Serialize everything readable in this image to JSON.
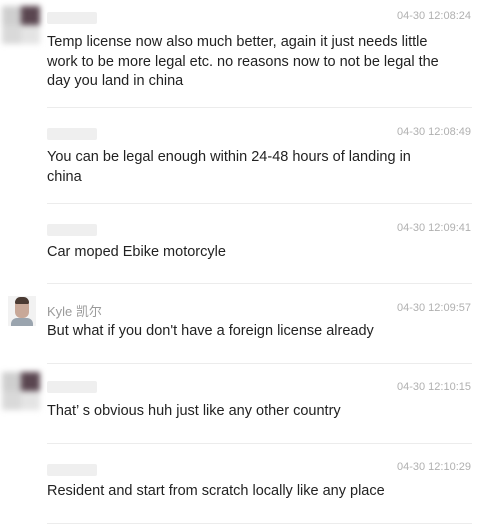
{
  "messages": [
    {
      "sender": "",
      "timestamp": "04-30 12:08:24",
      "text": "Temp license now also much better, again it just needs little work to be more legal etc. no reasons now to not be legal the day you land in china"
    },
    {
      "sender": "",
      "timestamp": "04-30 12:08:49",
      "text": "You can be legal enough within 24-48 hours of landing in china"
    },
    {
      "sender": "",
      "timestamp": "04-30 12:09:41",
      "text": "Car moped Ebike motorcyle"
    },
    {
      "sender": "Kyle 凯尔",
      "timestamp": "04-30 12:09:57",
      "text": "But what if you don't have a foreign license already"
    },
    {
      "sender": "",
      "timestamp": "04-30 12:10:15",
      "text": "That’ s obvious huh just like any other country"
    },
    {
      "sender": "",
      "timestamp": "04-30 12:10:29",
      "text": "Resident and start from scratch locally like any place"
    }
  ]
}
